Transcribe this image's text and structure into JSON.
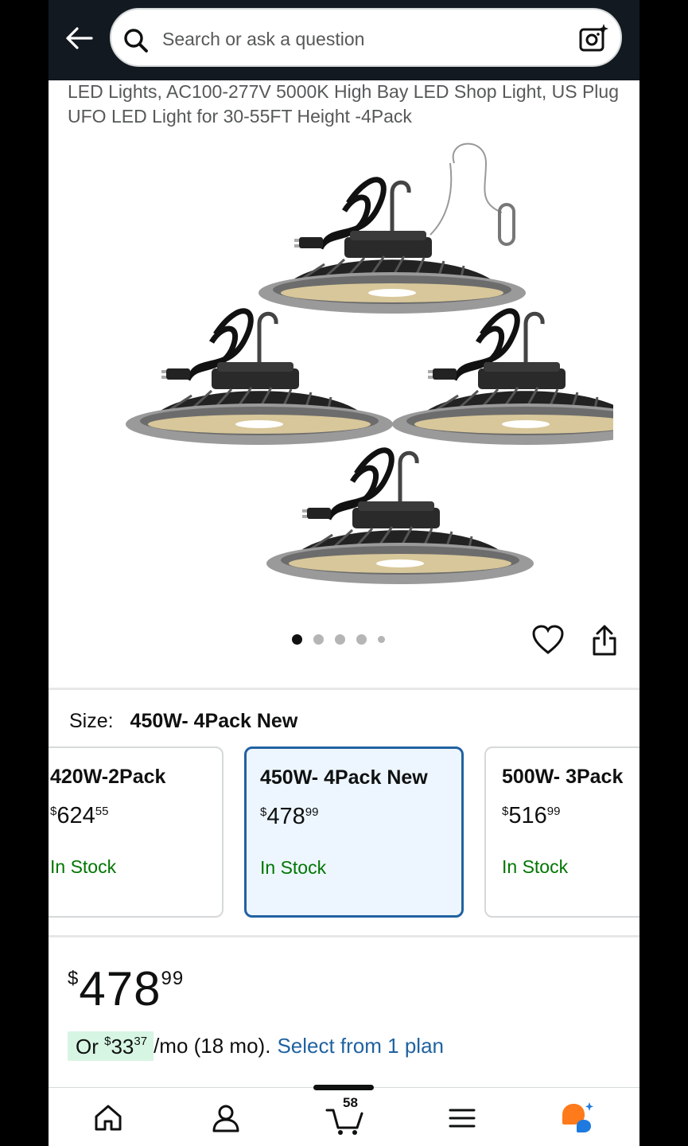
{
  "header": {
    "search_placeholder": "Search or ask a question"
  },
  "product": {
    "title": "LED Lights, AC100-277V 5000K High Bay LED Shop Light, US Plug UFO LED Light for 30-55FT Height -4Pack",
    "image_alt": "Four UFO high bay LED lights with plugs and hooks"
  },
  "gallery": {
    "image_count": 5,
    "active_index": 0
  },
  "size": {
    "label": "Size:",
    "selected": "450W- 4Pack New",
    "options": [
      {
        "name": "420W-2Pack",
        "price_sym": "$",
        "price_whole": "624",
        "price_cents": "55",
        "stock": "In Stock"
      },
      {
        "name": "450W- 4Pack New",
        "price_sym": "$",
        "price_whole": "478",
        "price_cents": "99",
        "stock": "In Stock"
      },
      {
        "name": "500W- 3Pack",
        "price_sym": "$",
        "price_whole": "516",
        "price_cents": "99",
        "stock": "In Stock"
      }
    ]
  },
  "price": {
    "symbol": "$",
    "whole": "478",
    "cents": "99",
    "monthly_prefix": "Or ",
    "monthly_sym": "$",
    "monthly_whole": "33",
    "monthly_cents": "37",
    "monthly_suffix": " /mo (18 mo).",
    "plan_link": "Select from 1 plan"
  },
  "nav": {
    "cart_count": "58"
  },
  "colors": {
    "header_bg": "#131921",
    "link": "#2162a1",
    "stock": "#007600",
    "selected_bg": "#edf6ff",
    "monthly_bg": "#d7f5e3"
  }
}
